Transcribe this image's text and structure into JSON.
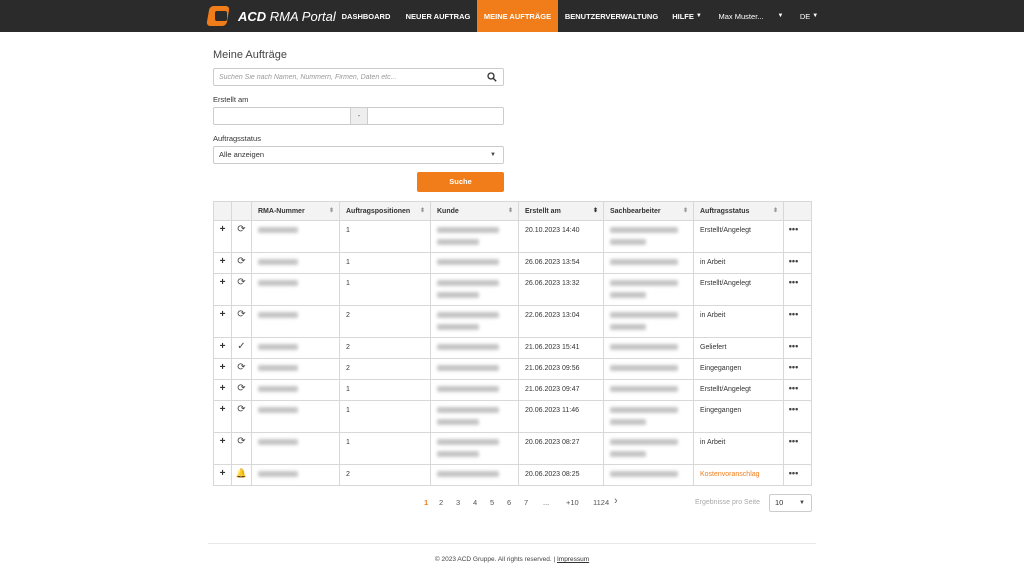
{
  "app": {
    "logo_bold": "ACD",
    "logo_rest": " RMA Portal"
  },
  "nav": {
    "dashboard": "DASHBOARD",
    "new_order": "NEUER AUFTRAG",
    "my_orders": "MEINE AUFTRÄGE",
    "user_mgmt": "BENUTZERVERWALTUNG",
    "help": "HILFE",
    "user": "Max Muster...",
    "lang": "DE"
  },
  "page": {
    "title": "Meine Aufträge",
    "search_placeholder": "Suchen Sie nach Namen, Nummern, Firmen, Daten etc...",
    "created_label": "Erstellt am",
    "date_separator": "-",
    "status_label": "Auftragsstatus",
    "status_value": "Alle anzeigen",
    "search_button": "Suche"
  },
  "table": {
    "headers": [
      "RMA-Nummer",
      "Auftragspositionen",
      "Kunde",
      "Erstellt am",
      "Sachbearbeiter",
      "Auftragsstatus"
    ],
    "rows": [
      {
        "icon": "refresh",
        "positions": "1",
        "created": "20.10.2023 14:40",
        "status": "Erstellt/Angelegt",
        "lines": 2
      },
      {
        "icon": "refresh",
        "positions": "1",
        "created": "26.06.2023 13:54",
        "status": "in Arbeit",
        "lines": 1
      },
      {
        "icon": "refresh",
        "positions": "1",
        "created": "26.06.2023 13:32",
        "status": "Erstellt/Angelegt",
        "lines": 2
      },
      {
        "icon": "refresh",
        "positions": "2",
        "created": "22.06.2023 13:04",
        "status": "in Arbeit",
        "lines": 2
      },
      {
        "icon": "check",
        "positions": "2",
        "created": "21.06.2023 15:41",
        "status": "Geliefert",
        "lines": 1
      },
      {
        "icon": "refresh",
        "positions": "2",
        "created": "21.06.2023 09:56",
        "status": "Eingegangen",
        "lines": 1
      },
      {
        "icon": "refresh",
        "positions": "1",
        "created": "21.06.2023 09:47",
        "status": "Erstellt/Angelegt",
        "lines": 1
      },
      {
        "icon": "refresh",
        "positions": "1",
        "created": "20.06.2023 11:46",
        "status": "Eingegangen",
        "lines": 2
      },
      {
        "icon": "refresh",
        "positions": "1",
        "created": "20.06.2023 08:27",
        "status": "in Arbeit",
        "lines": 2
      },
      {
        "icon": "bell",
        "positions": "2",
        "created": "20.06.2023 08:25",
        "status": "Kostenvoranschlag",
        "lines": 1
      }
    ]
  },
  "pagination": {
    "pages": [
      "1",
      "2",
      "3",
      "4",
      "5",
      "6",
      "7",
      "...",
      "+10",
      "1124"
    ],
    "current": "1",
    "per_page_label": "Ergebnisse pro Seite",
    "per_page_value": "10"
  },
  "footer": {
    "copyright": "© 2023 ACD Gruppe. All rights reserved. | ",
    "imprint": "Impressum"
  },
  "colors": {
    "accent": "#f07d1a",
    "nav_bg": "#2b2b2b"
  }
}
